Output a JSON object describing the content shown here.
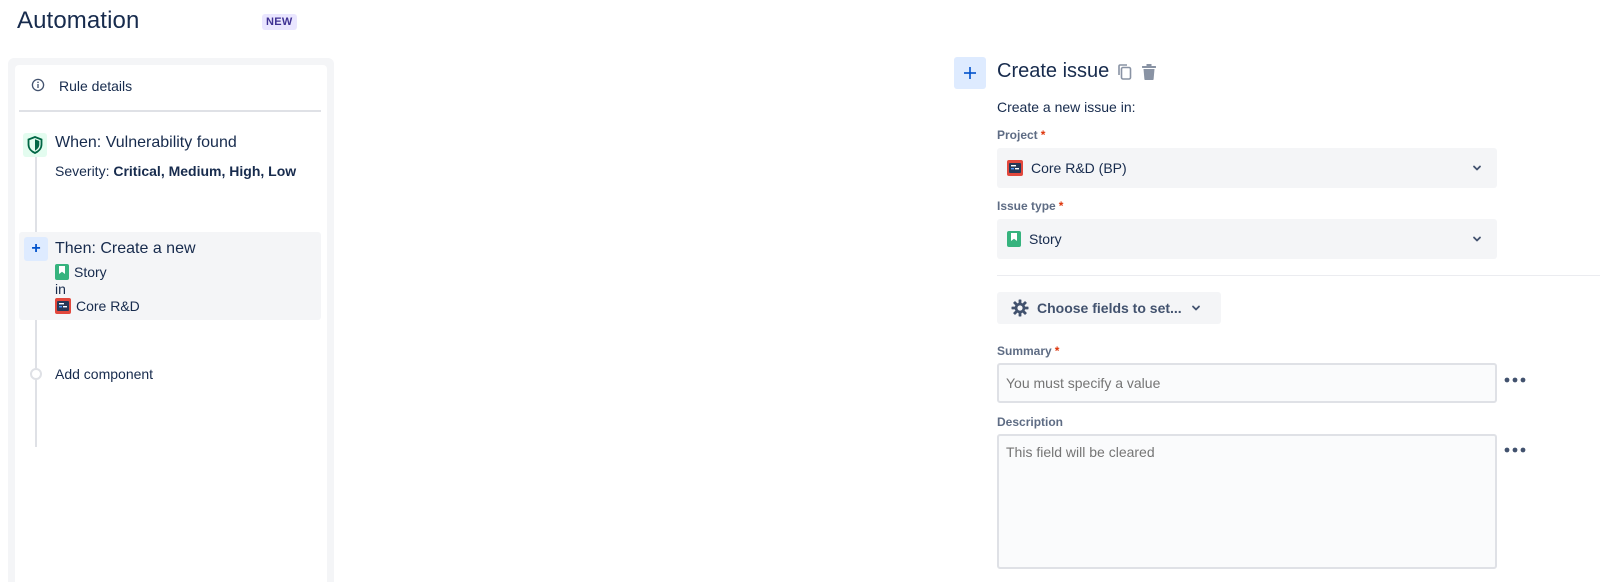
{
  "page": {
    "title": "Automation",
    "badge": "NEW"
  },
  "sidebar": {
    "rule_details": "Rule details",
    "trigger": {
      "title": "When: Vulnerability found",
      "severity_label": "Severity: ",
      "severity_values": "Critical, Medium, High, Low"
    },
    "action": {
      "title": "Then: Create a new",
      "issue_type": "Story",
      "connector": "in",
      "project": "Core R&D"
    },
    "add_component": "Add component"
  },
  "panel": {
    "title": "Create issue",
    "description": "Create a new issue in:",
    "project_label": "Project",
    "project_value": "Core R&D (BP)",
    "issue_type_label": "Issue type",
    "issue_type_value": "Story",
    "required_marker": "*",
    "choose_fields": "Choose fields to set...",
    "summary_label": "Summary",
    "summary_placeholder": "You must specify a value",
    "description_label": "Description",
    "description_placeholder": "This field will be cleared"
  },
  "colors": {
    "accent": "#0052cc",
    "required": "#de350b",
    "story": "#36b37e",
    "trigger_green": "#006644"
  }
}
